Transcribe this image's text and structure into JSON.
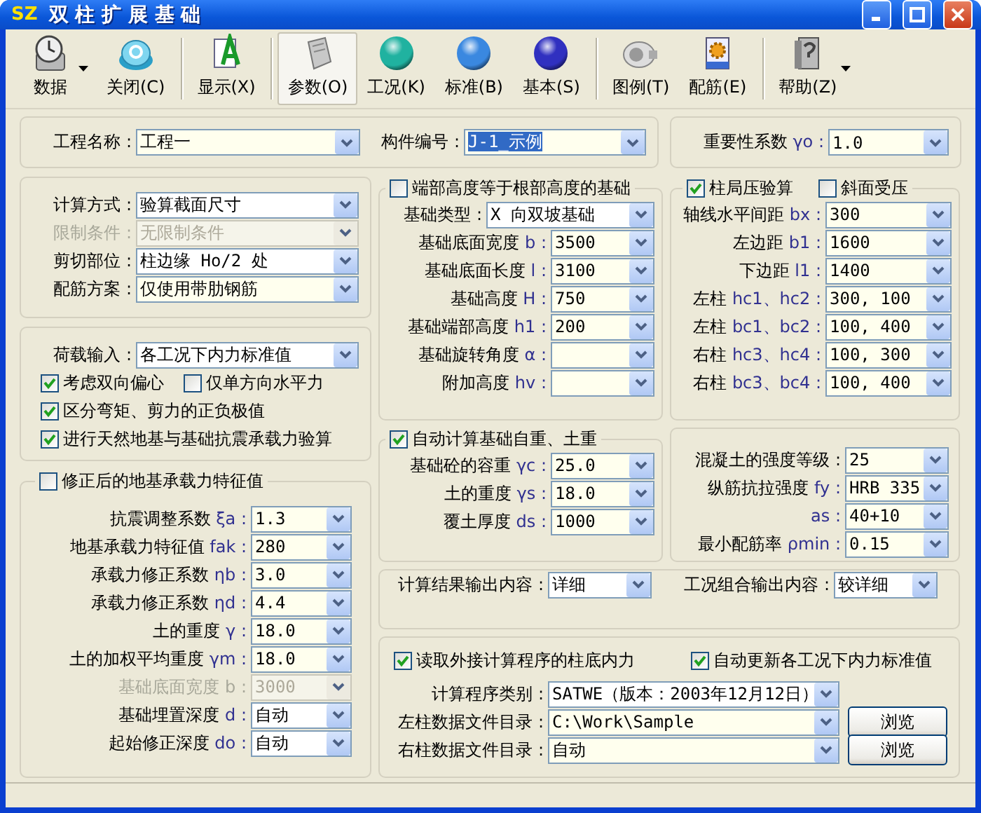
{
  "window": {
    "logo": "SZ",
    "title": "双 柱 扩 展 基 础"
  },
  "toolbar": [
    {
      "label": "数据",
      "kind": "clock",
      "menu": true,
      "separator": false,
      "selected": false
    },
    {
      "label": "关闭(C)",
      "kind": "disc",
      "menu": false,
      "separator": true,
      "selected": false
    },
    {
      "label": "显示(X)",
      "kind": "document",
      "menu": false,
      "separator": true,
      "selected": false
    },
    {
      "label": "参数(O)",
      "kind": "page",
      "menu": false,
      "separator": false,
      "selected": true
    },
    {
      "label": "工况(K)",
      "kind": "sphere",
      "color": "#20b2a0",
      "menu": false,
      "separator": false,
      "selected": false
    },
    {
      "label": "标准(B)",
      "kind": "sphere",
      "color": "#3a88e0",
      "menu": false,
      "separator": false,
      "selected": false
    },
    {
      "label": "基本(S)",
      "kind": "sphere",
      "color": "#3030c0",
      "menu": false,
      "separator": true,
      "selected": false
    },
    {
      "label": "图例(T)",
      "kind": "lens",
      "menu": false,
      "separator": false,
      "selected": false
    },
    {
      "label": "配筋(E)",
      "kind": "gear-doc",
      "menu": false,
      "separator": true,
      "selected": false
    },
    {
      "label": "帮助(Z)",
      "kind": "binder",
      "menu": true,
      "separator": false,
      "selected": false
    }
  ],
  "project": [
    {
      "label": "工程名称 :",
      "value": "工程一",
      "kind": "edit",
      "highlighted": false
    },
    {
      "label": "构件编号 :",
      "value": "J-1_示例",
      "kind": "edit",
      "highlighted": true
    }
  ],
  "importance": [
    {
      "label": "重要性系数 ",
      "symbol": "γo :",
      "value": "1.0",
      "kind": "edit"
    }
  ],
  "calc": [
    {
      "label": "计算方式 :",
      "value": "验算截面尺寸",
      "kind": "list",
      "disabled": false
    },
    {
      "label": "限制条件 :",
      "value": "无限制条件",
      "disabled": true
    },
    {
      "label": "剪切部位 :",
      "value": "柱边缘 Ho/2 处",
      "kind": "list",
      "disabled": false
    },
    {
      "label": "配筋方案 :",
      "value": "仅使用带肋钢筋",
      "kind": "edit",
      "disabled": false
    }
  ],
  "load": {
    "fields": [
      {
        "label": "荷载输入 :",
        "value": "各工况下内力标准值",
        "kind": "list"
      }
    ],
    "check_rows": [
      [
        {
          "label": "考虑双向偏心",
          "checked": true
        },
        {
          "label": "仅单方向水平力",
          "checked": false
        }
      ],
      [
        {
          "label": "区分弯矩、剪力的正负极值",
          "checked": true
        }
      ],
      [
        {
          "label": "进行天然地基与基础抗震承载力验算",
          "checked": true
        }
      ]
    ]
  },
  "bearing": {
    "checks": [
      {
        "label": "修正后的地基承载力特征值",
        "checked": false
      }
    ],
    "fields": [
      {
        "label": "抗震调整系数 ",
        "symbol": "ξa :",
        "value": "1.3",
        "kind": "edit",
        "disabled": false
      },
      {
        "label": "地基承载力特征值 ",
        "symbol": "fak :",
        "value": "280",
        "kind": "edit",
        "disabled": false
      },
      {
        "label": "承载力修正系数 ",
        "symbol": "ηb :",
        "value": "3.0",
        "kind": "edit",
        "disabled": false
      },
      {
        "label": "承载力修正系数 ",
        "symbol": "ηd :",
        "value": "4.4",
        "kind": "edit",
        "disabled": false
      },
      {
        "label": "土的重度 ",
        "symbol": "γ :",
        "value": "18.0",
        "kind": "edit",
        "disabled": false
      },
      {
        "label": "土的加权平均重度 ",
        "symbol": "γm :",
        "value": "18.0",
        "kind": "edit",
        "disabled": false
      },
      {
        "label": "基础底面宽度 ",
        "symbol": "b :",
        "value": "3000",
        "disabled": true
      },
      {
        "label": "基础埋置深度 ",
        "symbol": "d :",
        "value": "自动",
        "kind": "list",
        "disabled": false
      },
      {
        "label": "起始修正深度 ",
        "symbol": "do :",
        "value": "自动",
        "kind": "list",
        "disabled": false
      }
    ]
  },
  "base": {
    "checks": [
      {
        "label": "端部高度等于根部高度的基础",
        "checked": false
      }
    ],
    "fields": [
      {
        "label": "基础类型 :",
        "value": "X 向双坡基础",
        "kind": "list"
      },
      {
        "label": "基础底面宽度 ",
        "symbol": "b :",
        "value": "3500",
        "kind": "edit"
      },
      {
        "label": "基础底面长度 ",
        "symbol": "l :",
        "value": "3100",
        "kind": "edit"
      },
      {
        "label": "基础高度 ",
        "symbol": "H :",
        "value": "750",
        "kind": "edit"
      },
      {
        "label": "基础端部高度 ",
        "symbol": "h1 :",
        "value": "200",
        "kind": "edit"
      },
      {
        "label": "基础旋转角度 ",
        "symbol": "α :",
        "kind": "edit"
      },
      {
        "label": "附加高度 ",
        "symbol": "hv :",
        "kind": "edit"
      }
    ]
  },
  "local": {
    "checks": [
      {
        "label": "柱局压验算",
        "checked": true
      },
      {
        "label": "斜面受压",
        "checked": false
      }
    ],
    "fields": [
      {
        "label": "轴线水平间距 ",
        "symbol": "bx :",
        "value": "300",
        "kind": "edit"
      },
      {
        "label": "左边距 ",
        "symbol": "b1 :",
        "value": "1600",
        "kind": "edit"
      },
      {
        "label": "下边距 ",
        "symbol": "l1 :",
        "value": "1400",
        "kind": "edit"
      },
      {
        "label": "左柱 ",
        "symbol": "hc1、hc2 :",
        "value": "300, 100",
        "kind": "edit"
      },
      {
        "label": "左柱 ",
        "symbol": "bc1、bc2 :",
        "value": "100, 400",
        "kind": "edit"
      },
      {
        "label": "右柱 ",
        "symbol": "hc3、hc4 :",
        "value": "100, 300",
        "kind": "edit"
      },
      {
        "label": "右柱 ",
        "symbol": "bc3、bc4 :",
        "value": "100, 400",
        "kind": "edit"
      }
    ]
  },
  "auto": {
    "checks": [
      {
        "label": "自动计算基础自重、土重",
        "checked": true
      }
    ],
    "fields": [
      {
        "label": "基础砼的容重 ",
        "symbol": "γc :",
        "value": "25.0",
        "kind": "edit"
      },
      {
        "label": "土的重度 ",
        "symbol": "γs :",
        "value": "18.0",
        "kind": "edit"
      },
      {
        "label": "覆土厚度 ",
        "symbol": "ds :",
        "value": "1000",
        "kind": "edit"
      }
    ]
  },
  "concrete": [
    {
      "label": "混凝土的强度等级 :",
      "value": "25",
      "kind": "edit"
    },
    {
      "label": "纵筋抗拉强度 ",
      "symbol": "fy :",
      "value": "HRB 335",
      "kind": "edit"
    },
    {
      "symbol": "as :",
      "value": "40+10",
      "kind": "edit"
    },
    {
      "label": "最小配筋率 ",
      "symbol": "ρmin :",
      "value": "0.15",
      "kind": "edit"
    }
  ],
  "output": [
    {
      "label": "计算结果输出内容 :",
      "value": "详细",
      "kind": "list"
    },
    {
      "label": "工况组合输出内容 :",
      "value": "较详细",
      "kind": "list"
    }
  ],
  "read": {
    "checks": [
      {
        "label": "读取外接计算程序的柱底内力",
        "checked": true
      },
      {
        "label": "自动更新各工况下内力标准值",
        "checked": true
      }
    ],
    "fields": [
      {
        "label": "计算程序类别 :",
        "value": "SATWE（版本：2003年12月12日）",
        "kind": "list"
      },
      {
        "label": "左柱数据文件目录 :",
        "value": "C:\\Work\\Sample",
        "kind": "edit",
        "button": "浏览"
      },
      {
        "label": "右柱数据文件目录 :",
        "value": "自动",
        "kind": "edit",
        "button": "浏览"
      }
    ]
  }
}
